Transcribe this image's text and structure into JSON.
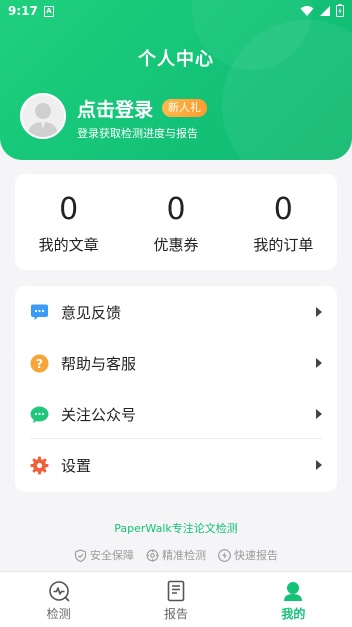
{
  "status_bar": {
    "time": "9:17",
    "notification_letter": "A"
  },
  "header": {
    "title": "个人中心",
    "login_title": "点击登录",
    "new_badge": "新人礼",
    "login_subtitle": "登录获取检测进度与报告"
  },
  "stats": [
    {
      "value": "0",
      "label": "我的文章"
    },
    {
      "value": "0",
      "label": "优惠券"
    },
    {
      "value": "0",
      "label": "我的订单"
    }
  ],
  "menu": [
    {
      "label": "意见反馈",
      "icon": "feedback-icon",
      "color": "#3b9cf5"
    },
    {
      "label": "帮助与客服",
      "icon": "help-icon",
      "color": "#f7a53b"
    },
    {
      "label": "关注公众号",
      "icon": "wechat-icon",
      "color": "#1fc77a"
    },
    {
      "label": "设置",
      "icon": "settings-icon",
      "color": "#f25f3a"
    }
  ],
  "footer": {
    "brand": "PaperWalk专注论文检测",
    "tags": [
      "安全保障",
      "精准检测",
      "快速报告"
    ]
  },
  "tabs": [
    {
      "label": "检测",
      "icon": "detect-icon"
    },
    {
      "label": "报告",
      "icon": "report-icon"
    },
    {
      "label": "我的",
      "icon": "profile-icon",
      "active": true
    }
  ],
  "colors": {
    "accent": "#13c277",
    "badge": "#ff9a2e"
  }
}
